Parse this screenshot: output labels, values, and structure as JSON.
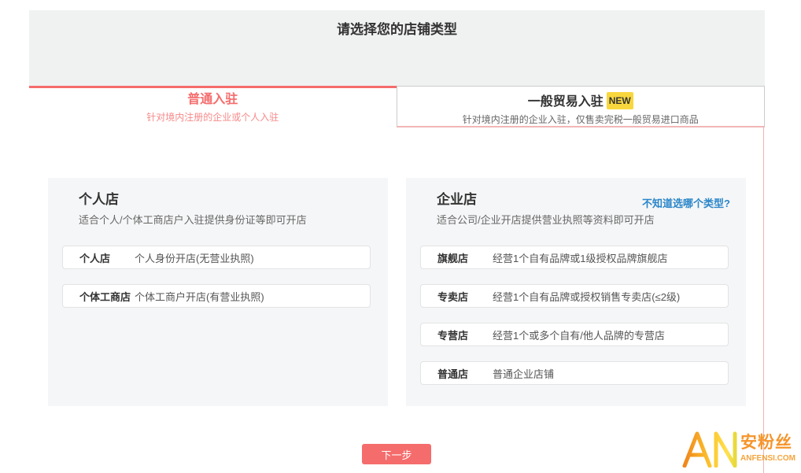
{
  "page": {
    "title": "请选择您的店铺类型"
  },
  "tabs": [
    {
      "title": "普通入驻",
      "subtitle": "针对境内注册的企业或个人入驻",
      "active": true
    },
    {
      "title": "一般贸易入驻",
      "badge": "NEW",
      "subtitle": "针对境内注册的企业入驻，仅售卖完税一般贸易进口商品",
      "active": false
    }
  ],
  "cards": [
    {
      "title": "个人店",
      "subtitle": "适合个人/个体工商店户入驻提供身份证等即可开店",
      "options": [
        {
          "label": "个人店",
          "desc": "个人身份开店(无营业执照)"
        },
        {
          "label": "个体工商店",
          "desc": "个体工商户开店(有营业执照)"
        }
      ]
    },
    {
      "title": "企业店",
      "help_link": "不知道选哪个类型?",
      "subtitle": "适合公司/企业开店提供营业执照等资料即可开店",
      "options": [
        {
          "label": "旗舰店",
          "desc": "经营1个自有品牌或1级授权品牌旗舰店"
        },
        {
          "label": "专卖店",
          "desc": "经营1个自有品牌或授权销售专卖店(≤2级)"
        },
        {
          "label": "专营店",
          "desc": "经营1个或多个自有/他人品牌的专营店"
        },
        {
          "label": "普通店",
          "desc": "普通企业店铺"
        }
      ]
    }
  ],
  "next_button": "下一步",
  "watermark": {
    "logo": "AN",
    "name": "安粉丝",
    "site": "ANFENSI.COM"
  },
  "colors": {
    "accent_red": "#f56c6c",
    "subtitle_red": "#f78989",
    "pink_border": "#efb3b3",
    "badge_yellow": "#f8d73e",
    "link_blue": "#2a86c9",
    "header_gray": "#f0f1f1",
    "card_gray": "#f5f6f7",
    "watermark_orange": "#f5952c"
  }
}
